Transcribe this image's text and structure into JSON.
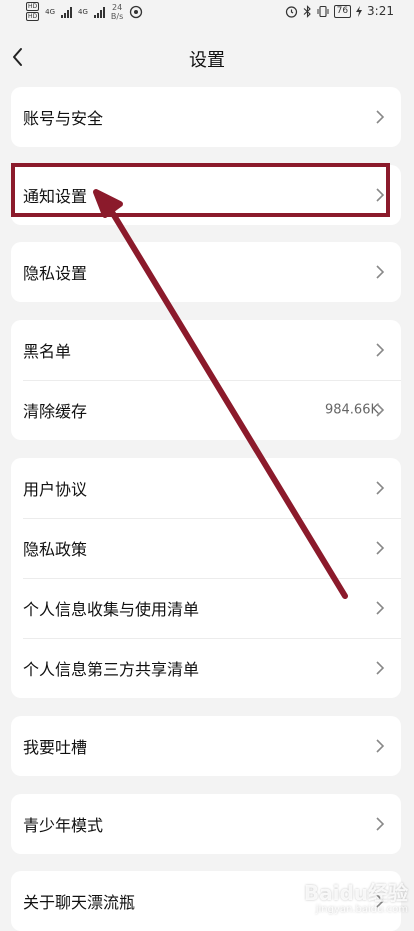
{
  "status_bar": {
    "network_left": "4G",
    "network_right": "4G",
    "speed_value": "24",
    "speed_unit": "B/s",
    "battery": "76",
    "time": "3:21"
  },
  "header": {
    "title": "设置"
  },
  "groups": [
    {
      "items": [
        {
          "label": "账号与安全"
        }
      ]
    },
    {
      "items": [
        {
          "label": "通知设置"
        }
      ]
    },
    {
      "items": [
        {
          "label": "隐私设置"
        }
      ]
    },
    {
      "items": [
        {
          "label": "黑名单"
        },
        {
          "label": "清除缓存",
          "value": "984.66K"
        }
      ]
    },
    {
      "items": [
        {
          "label": "用户协议"
        },
        {
          "label": "隐私政策"
        },
        {
          "label": "个人信息收集与使用清单"
        },
        {
          "label": "个人信息第三方共享清单"
        }
      ]
    },
    {
      "items": [
        {
          "label": "我要吐槽"
        }
      ]
    },
    {
      "items": [
        {
          "label": "青少年模式"
        }
      ]
    },
    {
      "items": [
        {
          "label": "关于聊天漂流瓶"
        }
      ]
    }
  ],
  "annotation": {
    "color": "#8b1a2b"
  },
  "watermark": {
    "main": "Baidu经验",
    "sub": "jingyan.baidu.com"
  }
}
